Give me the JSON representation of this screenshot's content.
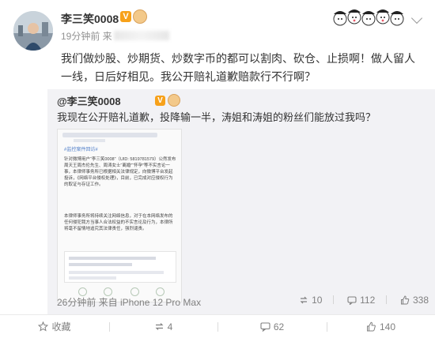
{
  "post": {
    "author": "李三笑0008",
    "vip_badge": "V",
    "time_prefix": "19分钟前 来",
    "text": "我们做炒股、炒期货、炒数字币的都可以割肉、砍仓、止损啊！做人留人一线，日后好相见。我公开赔礼道歉赔款行不行啊？"
  },
  "retweet": {
    "author": "@李三笑0008",
    "vip_badge": "V",
    "text": "我现在公开赔礼道歉，投降输一半，涛姐和涛姐的粉丝们能放过我吗？",
    "image": {
      "tag": "#监控案件回访#",
      "paragraph1": "针对微博用户“李三笑0008”（UID: 5819781579）公然发布周天王周杰伦先生、周涛女士“离婚”“怀孕”等不实言论一事，本律师事务所已根据相关法律规定，向微博平台发起投诉，《网络平台侵权处理》，目前，已完成对应侵权行为的取证与存证工作。",
      "paragraph2": "本律师事务所将持续关注网络信息，对于在本网络发布的任何侵犯我方当事人合法权益的不实言论及行为，本律所将毫不留情地追究其法律责任，强烈谴责。"
    },
    "meta": "26分钟前 来自 iPhone 12 Pro Max",
    "repost_count": "10",
    "comment_count": "112",
    "like_count": "338"
  },
  "actions": {
    "favorite": "收藏",
    "repost": "4",
    "comment": "62",
    "like": "140"
  },
  "colors": {
    "vip": "#f7a11a",
    "meta": "#808080",
    "retweet_bg": "#f2f2f5"
  }
}
